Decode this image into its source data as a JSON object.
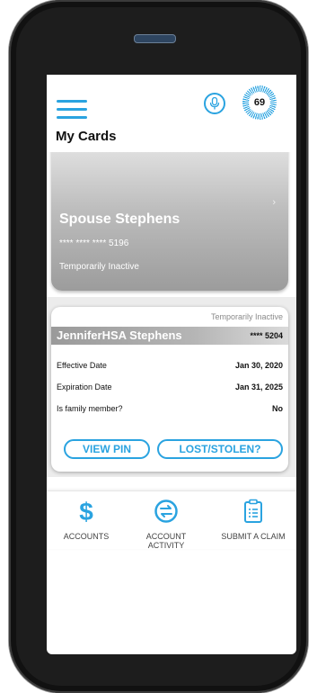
{
  "header": {
    "title": "My Cards",
    "score": "69",
    "menu_icon": "hamburger-menu-icon",
    "mic_icon": "microphone-icon",
    "score_icon": "score-badge-icon"
  },
  "cards": [
    {
      "name": "Spouse Stephens",
      "masked_number": "**** **** **** 5196",
      "status": "Temporarily Inactive",
      "chevron": "›"
    },
    {
      "status": "Temporarily Inactive",
      "holder": "JenniferHSA Stephens",
      "masked_number": "**** 5204",
      "details": [
        {
          "label": "Effective Date",
          "value": "Jan 30, 2020"
        },
        {
          "label": "Expiration Date",
          "value": "Jan 31, 2025"
        },
        {
          "label": "Is family member?",
          "value": "No"
        }
      ],
      "view_pin_label": "VIEW PIN",
      "lost_stolen_label": "LOST/STOLEN?"
    }
  ],
  "tabbar": {
    "items": [
      {
        "label": "ACCOUNTS",
        "icon": "dollar-icon"
      },
      {
        "label": "ACCOUNT ACTIVITY",
        "icon": "exchange-icon"
      },
      {
        "label": "SUBMIT A CLAIM",
        "icon": "clipboard-icon"
      }
    ]
  },
  "colors": {
    "accent": "#2aa3e0",
    "card_gray": "#a8a8a8",
    "text_dark": "#111111"
  }
}
